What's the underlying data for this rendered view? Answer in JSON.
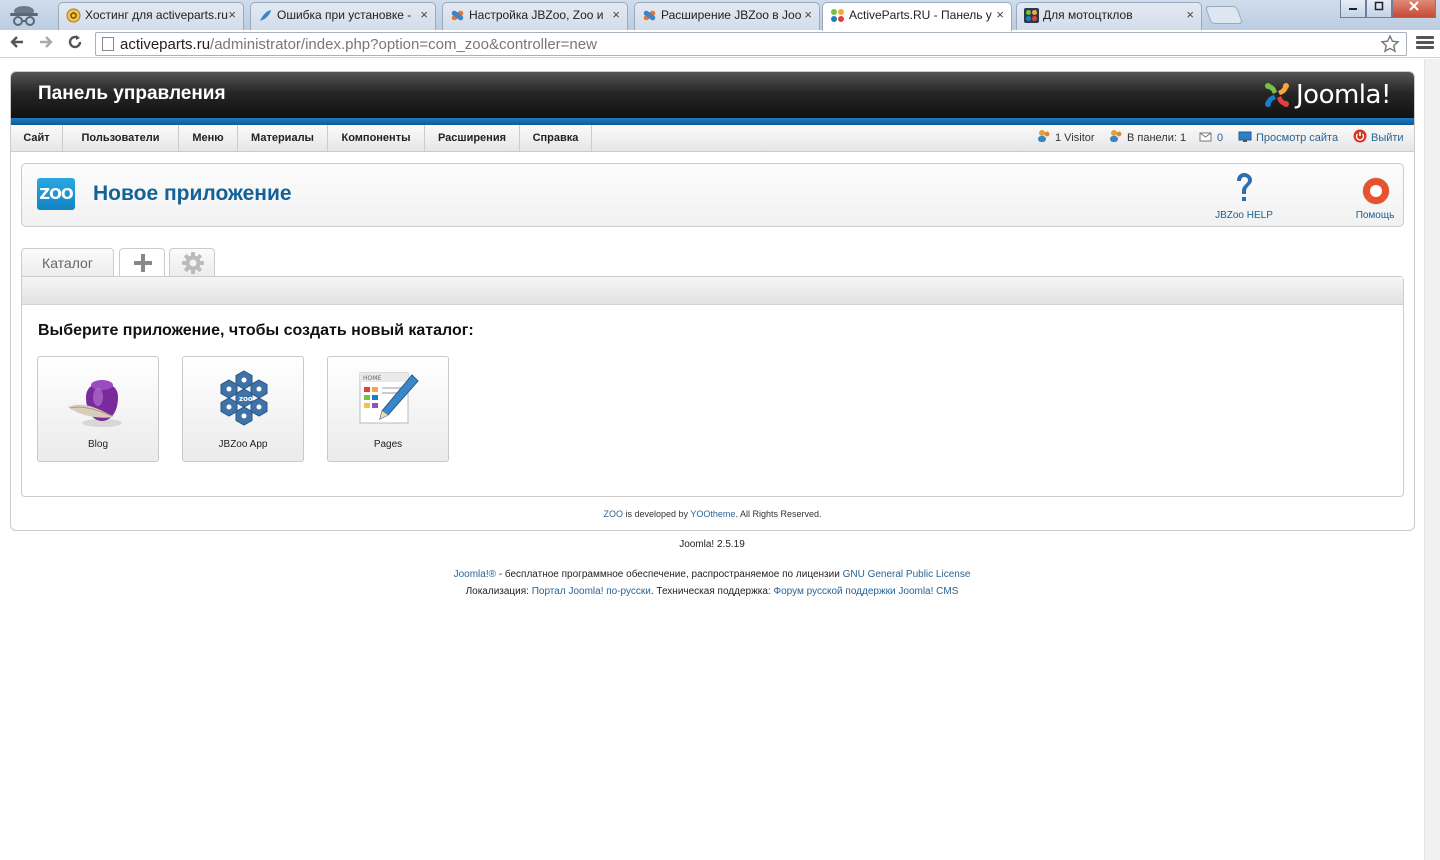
{
  "browser": {
    "tabs": [
      {
        "title": "Хостинг для activeparts.ru",
        "icon": "at-sign-icon"
      },
      {
        "title": "Ошибка при установке -",
        "icon": "feather-icon"
      },
      {
        "title": "Настройка JBZoo, Zoo и",
        "icon": "jbzoo-icon"
      },
      {
        "title": "Расширение JBZoo в Joo",
        "icon": "jbzoo-icon"
      },
      {
        "title": "ActiveParts.RU - Панель у",
        "icon": "joomla-icon",
        "active": true
      },
      {
        "title": "Для мотоцтклов",
        "icon": "joomla-icon"
      }
    ],
    "url_host": "activeparts.ru",
    "url_path": "/administrator/index.php?option=com_zoo&controller=new",
    "close_glyph": "×"
  },
  "header": {
    "title": "Панель управления",
    "logo_text": "Joomla!"
  },
  "admin_menu": [
    "Сайт",
    "Пользователи",
    "Меню",
    "Материалы",
    "Компоненты",
    "Расширения",
    "Справка"
  ],
  "status": {
    "visitors": "1 Visitor",
    "in_panel": "В панели: 1",
    "messages": "0",
    "view_site": "Просмотр сайта",
    "logout": "Выйти"
  },
  "toolbar": {
    "logo_text": "ZOO",
    "page_title": "Новое приложение",
    "help_label": "JBZoo HELP",
    "assist_label": "Помощь"
  },
  "tabs": {
    "catalog": "Каталог"
  },
  "content": {
    "heading": "Выберите приложение, чтобы создать новый каталог:",
    "apps": [
      {
        "name": "Blog",
        "icon": "ink-quill-icon"
      },
      {
        "name": "JBZoo App",
        "icon": "hexagon-cluster-icon"
      },
      {
        "name": "Pages",
        "icon": "pencil-page-icon",
        "page_label": "HOME"
      }
    ]
  },
  "zoo_credit": {
    "zoo": "ZOO",
    "developed_by": " is developed by ",
    "yootheme": "YOOtheme",
    "rights": ". All Rights Reserved."
  },
  "footer": {
    "version": "Joomla! 2.5.19",
    "joomla_link": "Joomla!®",
    "license_text": " - бесплатное программное обеспечение, распространяемое по лицензии ",
    "gpl_link": "GNU General Public License",
    "localization_label": "Локализация: ",
    "portal_link": "Портал Joomla! по-русски",
    "support_label": ". Техническая поддержка: ",
    "forum_link": "Форум русской поддержки Joomla! CMS"
  },
  "colors": {
    "brand_blue": "#146295",
    "header_dark": "#111111",
    "strip_blue": "#1d7bbf",
    "link": "#2a6496"
  }
}
